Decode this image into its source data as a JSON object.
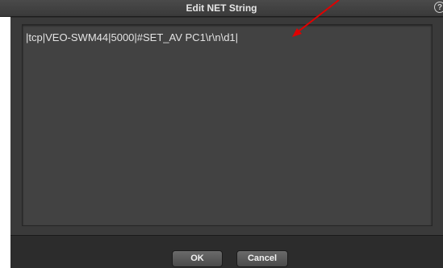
{
  "window": {
    "title": "Edit NET String",
    "help_glyph": "?"
  },
  "editor": {
    "value": "|tcp|VEO-SWM44|5000|#SET_AV PC1\\r\\n\\d1|"
  },
  "buttons": {
    "ok_label": "OK",
    "cancel_label": "Cancel"
  },
  "colors": {
    "window_bg": "#2b2b2b",
    "editor_bg": "#424242",
    "text": "#e4e4e4",
    "annotation_arrow": "#e00000"
  }
}
